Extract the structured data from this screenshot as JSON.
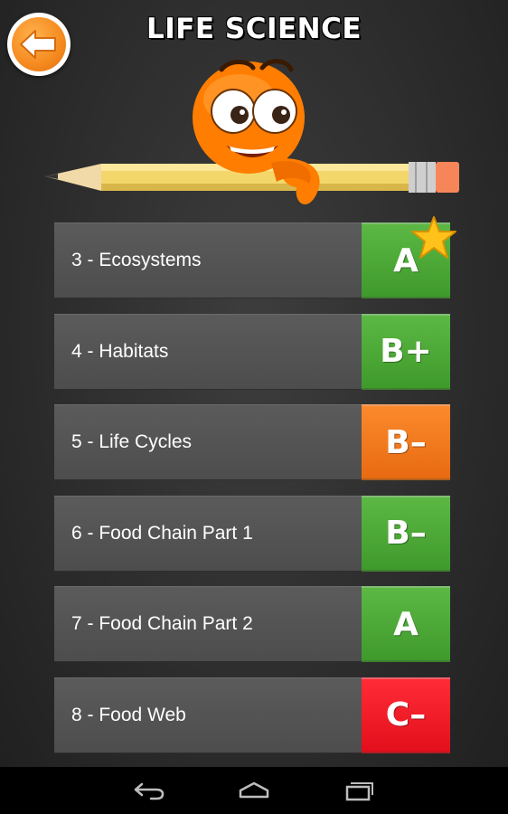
{
  "header": {
    "title": "LIFE SCIENCE",
    "back_icon": "arrow-left-icon"
  },
  "lessons": [
    {
      "label": "3 - Ecosystems",
      "grade": "A",
      "grade_color": "green",
      "starred": true
    },
    {
      "label": "4 - Habitats",
      "grade": "B+",
      "grade_color": "green",
      "starred": false
    },
    {
      "label": "5 - Life Cycles",
      "grade": "B–",
      "grade_color": "orange",
      "starred": false
    },
    {
      "label": "6 - Food Chain Part 1",
      "grade": "B–",
      "grade_color": "green",
      "starred": false
    },
    {
      "label": "7 - Food Chain Part 2",
      "grade": "A",
      "grade_color": "green",
      "starred": false
    },
    {
      "label": "8 - Food Web",
      "grade": "C–",
      "grade_color": "red",
      "starred": false
    }
  ],
  "colors": {
    "green": "#4caf36",
    "orange": "#f47a1f",
    "red": "#f21b27",
    "mascot": "#ff7a00",
    "star": "#ffc21a"
  },
  "navbar": {
    "icons": [
      "back-nav-icon",
      "home-nav-icon",
      "recents-nav-icon"
    ]
  }
}
